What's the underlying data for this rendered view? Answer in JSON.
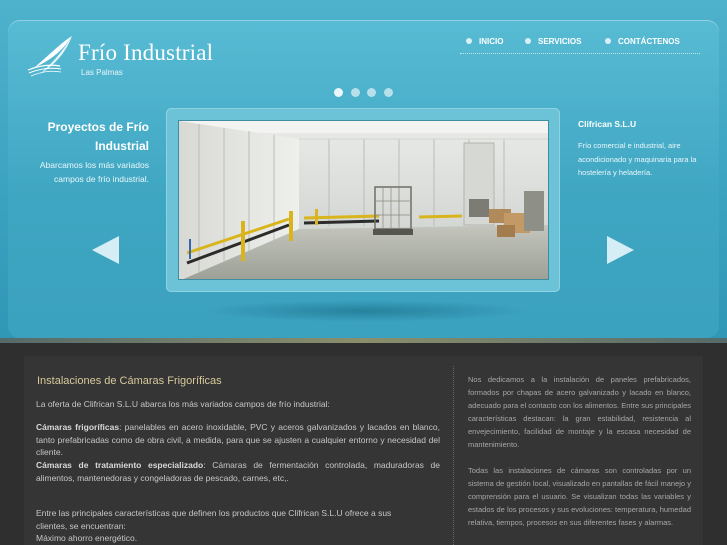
{
  "brand": {
    "title": "Frío Industrial",
    "subtitle": "Las Palmas"
  },
  "nav": {
    "items": [
      {
        "label": "INICIO"
      },
      {
        "label": "SERVICIOS"
      },
      {
        "label": "CONTÁCTENOS"
      }
    ]
  },
  "slider": {
    "dot_count": 4,
    "active_index": 0
  },
  "hero_left": {
    "title": "Proyectos de Frío Industrial",
    "text": "Abarcamos los más variados campos de frío industrial."
  },
  "hero_right": {
    "title": "Clifrican S.L.U",
    "text": "Frío comercial e industrial, aire acondicionado y maquinaria para la hostelería y heladería."
  },
  "content": {
    "title": "Instalaciones de Cámaras Frigoríficas",
    "intro": "La oferta de Clifrican S.L.U abarca los más variados campos de frío industrial:",
    "item1_label": "Cámaras frigoríficas",
    "item1_text": ": panelables en acero inoxidable, PVC y aceros galvanizados y lacados en blanco, tanto prefabricadas como de obra civil, a medida, para que se ajusten a cualquier entorno y necesidad del cliente.",
    "item2_label": "Cámaras de tratamiento especializado",
    "item2_text": ": Cámaras de fermentación controlada, maduradoras de alimentos, mantenedoras y congeladoras de pescado, carnes, etc,.",
    "features_intro": "Entre las principales características que definen los productos que Clifrican S.L.U ofrece a sus clientes, se encuentran:",
    "feature1": "Máximo ahorro energético.",
    "right_p1": "Nos dedicamos a la instalación de paneles prefabricados, formados por chapas de acero galvanizado y lacado en blanco, adecuado para el contacto con los alimentos. Entre sus principales características destacan: la gran estabilidad, resistencia al envejecimiento, facilidad de montaje y la escasa necesidad de mantenimiento.",
    "right_p2": "Todas las instalaciones de cámaras son controladas por un sistema de gestión local, visualizado en pantallas de fácil manejo y comprensión para el usuario. Se visualizan todas las variables y estados de los procesos y sus evoluciones: temperatura, humedad relativa, tiempos, procesos en sus diferentes fases y alarmas."
  },
  "colors": {
    "hero_blue": "#3ea6c2",
    "content_bg": "#353535",
    "title_gold": "#d8c99a"
  },
  "icons": [
    "logo-swoosh-icon",
    "prev-arrow-icon",
    "next-arrow-icon",
    "nav-bullet-icon"
  ]
}
